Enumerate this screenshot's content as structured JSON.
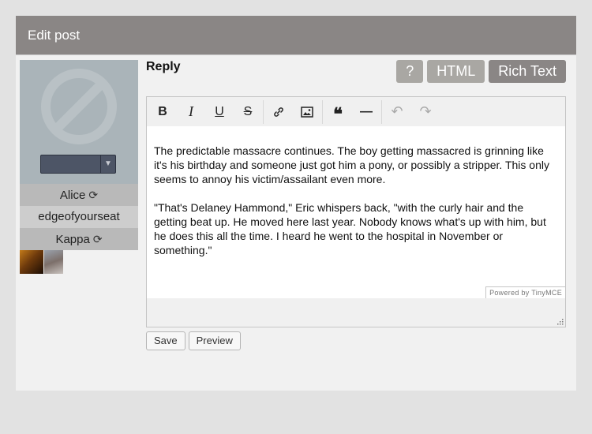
{
  "panel": {
    "title": "Edit post"
  },
  "sidebar": {
    "avatar_icon": "no-avatar-icon",
    "avatar_select_value": "",
    "rows": [
      {
        "label": "Alice",
        "sync_icon": "⟳"
      },
      {
        "label": "edgeofyourseat"
      },
      {
        "label": "Kappa",
        "sync_icon": "⟳"
      }
    ]
  },
  "reply": {
    "label": "Reply",
    "modes": {
      "help": "?",
      "html": "HTML",
      "rich": "Rich Text"
    },
    "toolbar": {
      "bold": "B",
      "italic": "I",
      "underline": "U",
      "strike": "S",
      "link_icon": "link-icon",
      "image_icon": "image-icon",
      "quote": "❝",
      "hr": "—",
      "undo": "↶",
      "redo": "↷"
    },
    "content": {
      "p1": "The predictable massacre continues. The boy getting massacred is grinning like it's his birthday and someone just got him a pony, or possibly a stripper. This only seems to annoy his victim/assailant even more.",
      "p2": "\"That's Delaney Hammond,\" Eric whispers back, \"with the curly hair and the getting beat up. He moved here last year. Nobody knows what's up with him, but he does this all the time. I heard he went to the hospital in November or something.\""
    },
    "powered_by": "Powered by TinyMCE",
    "save_label": "Save",
    "preview_label": "Preview"
  },
  "colors": {
    "header": "#8a8685",
    "mode_button": "#a9a7a3",
    "page_bg": "#e2e2e2",
    "panel_bg": "#f1f1f1"
  }
}
